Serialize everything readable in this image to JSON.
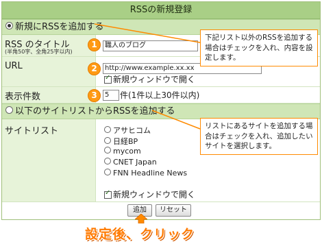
{
  "window": {
    "title": "RSSの新規登録"
  },
  "section_new": {
    "label": "新規にRSSを追加する",
    "selected": true
  },
  "fields": {
    "title": {
      "label": "RSS のタイトル",
      "sublabel": "(半角50字、全角25字以内)",
      "step": "1",
      "value": "職人のブログ"
    },
    "url": {
      "label": "URL",
      "step": "2",
      "value": "http://www.example.xx.xx",
      "new_window_label": "新規ウィンドウで開く",
      "new_window_checked": true
    },
    "count": {
      "label": "表示件数",
      "step": "3",
      "value": "5",
      "suffix": "件(1件以上30件以内)"
    }
  },
  "section_list": {
    "label": "以下のサイトリストからRSSを追加する",
    "selected": false
  },
  "site_list": {
    "label": "サイトリスト",
    "options": [
      "アサヒコム",
      "日経BP",
      "mycom",
      "CNET Japan",
      "FNN Headline News"
    ],
    "new_window_label": "新規ウィンドウで開く",
    "new_window_checked": true
  },
  "callouts": {
    "new_rss": "下記リスト以外のRSSを追加する場合はチェックを入れ、内容を設定します。",
    "site_list": "リストにあるサイトを追加する場合はチェックを入れ、追加したいサイトを選択します。"
  },
  "buttons": {
    "add": "追加",
    "reset": "リセット"
  },
  "caption": "設定後、クリック",
  "colors": {
    "title_bar": "#a9cf86",
    "section": "#cfe6b6",
    "label_bg": "#e7f3d9",
    "accent": "#ff8a00"
  }
}
